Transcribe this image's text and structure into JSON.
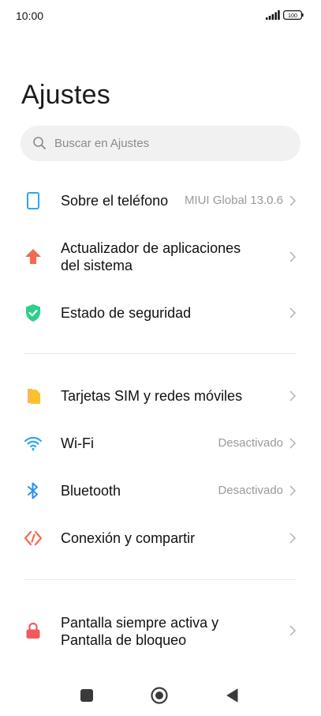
{
  "status": {
    "time": "10:00",
    "battery": "100"
  },
  "header": {
    "title": "Ajustes"
  },
  "search": {
    "placeholder": "Buscar en Ajustes"
  },
  "items": [
    {
      "label": "Sobre el teléfono",
      "value": "MIUI Global 13.0.6",
      "icon": "phone-icon",
      "color": "#2fa7f0"
    },
    {
      "label_line1": "Actualizador de aplicaciones",
      "label_line2": "del sistema",
      "icon": "update-arrow-icon",
      "color": "#f26b4f"
    },
    {
      "label": "Estado de seguridad",
      "icon": "shield-check-icon",
      "color": "#2dd08a"
    },
    {
      "label": "Tarjetas SIM y redes móviles",
      "icon": "sim-card-icon",
      "color": "#fbc02d"
    },
    {
      "label": "Wi-Fi",
      "value": "Desactivado",
      "icon": "wifi-icon",
      "color": "#2fa7f0"
    },
    {
      "label": "Bluetooth",
      "value": "Desactivado",
      "icon": "bluetooth-icon",
      "color": "#2f8ff0"
    },
    {
      "label": "Conexión y compartir",
      "icon": "share-connection-icon",
      "color": "#f26b4f"
    },
    {
      "label_line1": "Pantalla siempre activa y",
      "label_line2": "Pantalla de bloqueo",
      "icon": "lock-icon",
      "color": "#f25a5a"
    }
  ],
  "navbar": {
    "buttons": [
      "recents-square-icon",
      "home-circle-icon",
      "back-triangle-icon"
    ]
  }
}
